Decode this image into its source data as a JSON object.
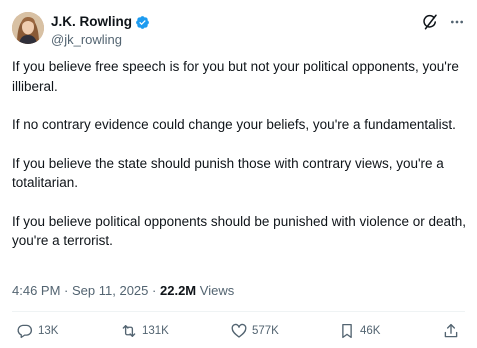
{
  "author": {
    "display_name": "J.K. Rowling",
    "handle": "@jk_rowling",
    "verified": true,
    "verified_color": "#1d9bf0"
  },
  "header_icons": [
    "grok-icon",
    "more-icon"
  ],
  "tweet": {
    "paragraphs": [
      "If you believe free speech is for you but not your political opponents, you're illiberal.",
      "If no contrary evidence could change your beliefs, you're a fundamentalist.",
      "If you believe the state should punish those with contrary views, you're a totalitarian.",
      "If you believe political opponents should be punished with violence or death, you're a terrorist."
    ]
  },
  "meta": {
    "time": "4:46 PM",
    "separator": "·",
    "date": "Sep 11, 2025",
    "views_count": "22.2M",
    "views_label": "Views"
  },
  "actions": {
    "replies": "13K",
    "reposts": "131K",
    "likes": "577K",
    "bookmarks": "46K"
  },
  "colors": {
    "text_primary": "#0f1419",
    "text_secondary": "#536471",
    "divider": "#eff3f4",
    "accent": "#1d9bf0"
  }
}
